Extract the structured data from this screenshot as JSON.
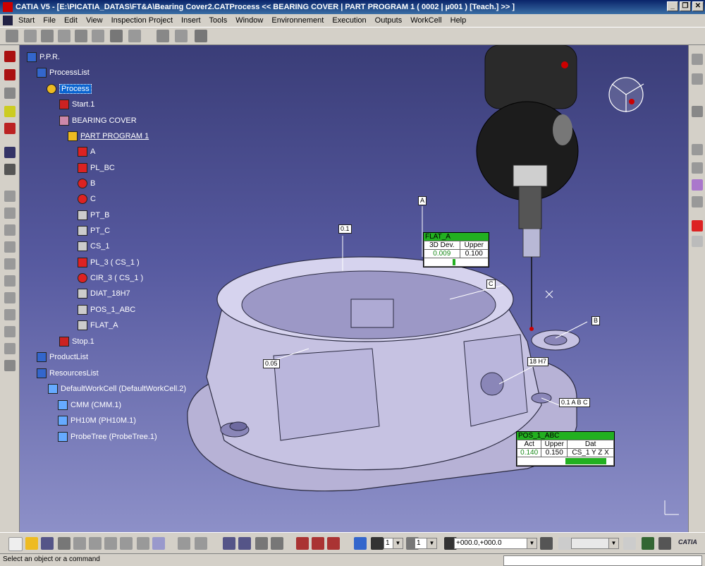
{
  "window": {
    "title": "CATIA V5 - [E:\\PICATIA_DATAS\\FT&A\\Bearing Cover2.CATProcess << BEARING COVER  |  PART PROGRAM 1  ( 0002  |  µ001 )  [Teach.]  >> ]",
    "minimize": "_",
    "restore": "❐",
    "close": "✕"
  },
  "menu": {
    "items": [
      "Start",
      "File",
      "Edit",
      "View",
      "Inspection Project",
      "Insert",
      "Tools",
      "Window",
      "Environnement",
      "Execution",
      "Outputs",
      "WorkCell",
      "Help"
    ]
  },
  "tree": {
    "root": "P.P.R.",
    "process_list": "ProcessList",
    "process": "Process",
    "start": "Start.1",
    "bearing_cover": "BEARING COVER",
    "part_program": "PART PROGRAM 1",
    "features": [
      "A",
      "PL_BC",
      "B",
      "C",
      "PT_B",
      "PT_C",
      "CS_1",
      "PL_3 ( CS_1 )",
      "CIR_3 ( CS_1 )",
      "DIAT_18H7",
      "POS_1_ABC",
      "FLAT_A"
    ],
    "stop": "Stop.1",
    "product_list": "ProductList",
    "resources_list": "ResourcesList",
    "workcell": "DefaultWorkCell (DefaultWorkCell.2)",
    "resources": [
      "CMM (CMM.1)",
      "PH10M (PH10M.1)",
      "ProbeTree (ProbeTree.1)"
    ]
  },
  "flat_dialog": {
    "title": "FLAT_A",
    "col1": "3D Dev.",
    "col2": "Upper",
    "value": "0.009",
    "upper": "0.100",
    "level": 0.45
  },
  "pos_dialog": {
    "title": "POS_1_ABC",
    "col1": "Act",
    "col2": "Upper",
    "col3": "Dat",
    "value": "0.140",
    "upper": "0.150",
    "datum": "CS_1 Y Z X",
    "level": 0.93
  },
  "annotations": {
    "datum_a": "A",
    "datum_b": "B",
    "datum_c": "C",
    "flatness": "0.1",
    "perp": "0.05",
    "dia": "18 H7",
    "pos": "0.1 A B C",
    "gtol_b": "B"
  },
  "bottom": {
    "combo1": "1",
    "combo2": "1",
    "coords": "+000.0,+000.0",
    "cmm_logo": "CATIA"
  },
  "status": {
    "prompt": "Select an object or a command"
  },
  "colors": {
    "accent_green": "#22b020",
    "viewport_top": "#3a3d78",
    "part": "#b7b2d6"
  }
}
